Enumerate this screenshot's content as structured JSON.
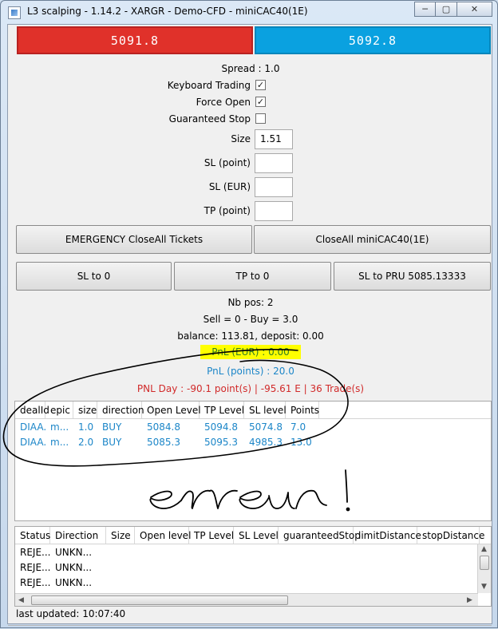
{
  "window": {
    "title": "L3 scalping - 1.14.2 - XARGR - Demo-CFD - miniCAC40(1E)",
    "minimize": "─",
    "maximize": "▢",
    "close": "✕"
  },
  "prices": {
    "bid": "5091.8",
    "ask": "5092.8",
    "bid_color": "#e0312a",
    "ask_color": "#0aa1e0"
  },
  "settings": {
    "spread": "Spread : 1.0",
    "keyboard_trading": "Keyboard Trading",
    "keyboard_trading_checked": true,
    "force_open": "Force Open",
    "force_open_checked": true,
    "guaranteed_stop": "Guaranteed Stop",
    "guaranteed_stop_checked": false,
    "size_label": "Size",
    "size_value": "1.51",
    "sl_point_label": "SL (point)",
    "sl_point_value": "",
    "sl_eur_label": "SL (EUR)",
    "sl_eur_value": "",
    "tp_point_label": "TP (point)",
    "tp_point_value": "",
    "check_mark": "✓"
  },
  "actions": {
    "emergency_close_all": "EMERGENCY CloseAll Tickets",
    "close_all_instrument": "CloseAll miniCAC40(1E)",
    "sl_to_0": "SL to 0",
    "tp_to_0": "TP to 0",
    "sl_to_pru": "SL to PRU 5085.13333"
  },
  "summary": {
    "nb_pos": "Nb pos: 2",
    "sell_buy": "Sell = 0 - Buy = 3.0",
    "balance": "balance: 113.81, deposit: 0.00",
    "pnl_eur": "PnL (EUR) : 0.00",
    "pnl_points": "PnL (points) : 20.0",
    "pnl_day": "PNL Day : -90.1 point(s) | -95.61 E | 36 Trade(s)",
    "highlight_color": "#ffff00"
  },
  "positions": {
    "columns": [
      "dealId",
      "epic",
      "size",
      "direction",
      "Open Level",
      "TP Level",
      "SL level",
      "Points"
    ],
    "rows": [
      [
        "DIAA...",
        "m...",
        "1.0",
        "BUY",
        "5084.8",
        "5094.8",
        "5074.8",
        "7.0"
      ],
      [
        "DIAA...",
        "m...",
        "2.0",
        "BUY",
        "5085.3",
        "5095.3",
        "4985.3",
        "13.0"
      ]
    ]
  },
  "annotation": {
    "text": "erreur !"
  },
  "orders": {
    "columns": [
      "Status",
      "Direction",
      "Size",
      "Open level",
      "TP Level",
      "SL Level",
      "guaranteedStop",
      "limitDistance",
      "stopDistance"
    ],
    "rows": [
      [
        "REJE...",
        "UNKN..."
      ],
      [
        "REJE...",
        "UNKN..."
      ],
      [
        "REJE...",
        "UNKN..."
      ]
    ]
  },
  "status": {
    "last_updated": "last updated: 10:07:40"
  }
}
